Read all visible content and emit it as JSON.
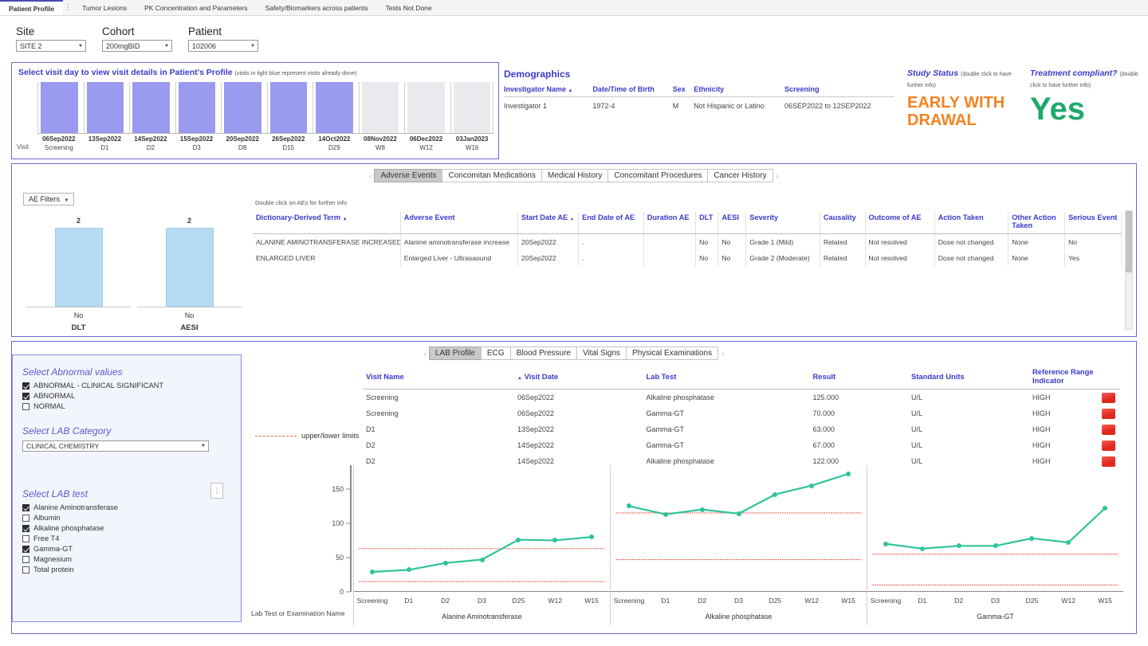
{
  "topbar": {
    "tabs": [
      {
        "label": "Patient Profile",
        "active": true
      },
      {
        "label": "Tumor Lesions",
        "active": false
      },
      {
        "label": "PK Concentration and Parameters",
        "active": false
      },
      {
        "label": "Safety/Biomarkers across patients",
        "active": false
      },
      {
        "label": "Tests Not Done",
        "active": false
      }
    ],
    "kebab": "⋮"
  },
  "selectors": [
    {
      "label": "Site",
      "value": "SITE 2"
    },
    {
      "label": "Cohort",
      "value": "200mgBID"
    },
    {
      "label": "Patient",
      "value": "102006"
    }
  ],
  "visit_panel": {
    "title": "Select visit day to view visit details in Patient's Profile",
    "subtitle": "(visits in light blue represent visits already done)",
    "row_label": "Visit",
    "visits": [
      {
        "date": "06Sep2022",
        "visit": "Screening",
        "done": true
      },
      {
        "date": "13Sep2022",
        "visit": "D1",
        "done": true
      },
      {
        "date": "14Sep2022",
        "visit": "D2",
        "done": true
      },
      {
        "date": "15Sep2022",
        "visit": "D3",
        "done": true
      },
      {
        "date": "20Sep2022",
        "visit": "D8",
        "done": true
      },
      {
        "date": "26Sep2022",
        "visit": "D15",
        "done": true
      },
      {
        "date": "14Oct2022",
        "visit": "D29",
        "done": true
      },
      {
        "date": "08Nov2022",
        "visit": "W8",
        "done": false
      },
      {
        "date": "06Dec2022",
        "visit": "W12",
        "done": false
      },
      {
        "date": "03Jan2023",
        "visit": "W16",
        "done": false
      }
    ]
  },
  "demographics": {
    "title": "Demographics",
    "columns": [
      "Investigator Name",
      "Date/Time of Birth",
      "Sex",
      "Ethnicity",
      "Screening"
    ],
    "rows": [
      [
        "Investigator 1",
        "1972-4",
        "M",
        "Not Hispanic or Latino",
        "06SEP2022 to 12SEP2022"
      ]
    ]
  },
  "study_status": {
    "label": "Study Status",
    "note": "(double click to have further info)",
    "value": "EARLY WITHDRAWAL",
    "color": "#f58220"
  },
  "treatment_compliant": {
    "label": "Treatment compliant?",
    "note": "(double click to have further info)",
    "value": "Yes",
    "color": "#1fa96a"
  },
  "ae_section": {
    "tabs": [
      {
        "label": "Adverse Events",
        "active": true
      },
      {
        "label": "Concomitan Medications",
        "active": false
      },
      {
        "label": "Medical History",
        "active": false
      },
      {
        "label": "Concomitant Procedures",
        "active": false
      },
      {
        "label": "Cancer History",
        "active": false
      }
    ],
    "prev_arrow": "‹",
    "next_arrow": "›",
    "filters_label": "AE Filters",
    "hint": "Double click on AEs for further info",
    "bars": [
      {
        "name": "DLT",
        "category": "No",
        "value": "2"
      },
      {
        "name": "AESI",
        "category": "No",
        "value": "2"
      }
    ],
    "columns": [
      "Dictionary-Derived Term",
      "Adverse Event",
      "Start Date AE",
      "End Date of AE",
      "Duration AE",
      "DLT",
      "AESI",
      "Severity",
      "Causality",
      "Outcome of AE",
      "Action Taken",
      "Other Action Taken",
      "Serious Event"
    ],
    "rows": [
      [
        "ALANINE AMINOTRANSFERASE INCREASED",
        "Alanine aminotransferase increase",
        "20Sep2022",
        ".",
        "",
        "No",
        "No",
        "Grade 1 (Mild)",
        "Related",
        "Not resolved",
        "Dose not changed",
        "None",
        "No"
      ],
      [
        "ENLARGED LIVER",
        "Enlarged Liver - Ultrasaound",
        "20Sep2022",
        ".",
        "",
        "No",
        "No",
        "Grade 2 (Moderate)",
        "Related",
        "Not resolved",
        "Dose not changed",
        "None",
        "Yes"
      ]
    ]
  },
  "lab_section": {
    "tabs": [
      {
        "label": "LAB Profile",
        "active": true
      },
      {
        "label": "ECG",
        "active": false
      },
      {
        "label": "Blood Pressure",
        "active": false
      },
      {
        "label": "Vital Signs",
        "active": false
      },
      {
        "label": "Physical Examinations",
        "active": false
      }
    ],
    "prev_arrow": "‹",
    "next_arrow": "›",
    "filters": {
      "abnormal_title": "Select Abnormal values",
      "abnormal_options": [
        {
          "label": "ABNORMAL - CLINICAL SIGNIFICANT",
          "checked": true
        },
        {
          "label": "ABNORMAL",
          "checked": true
        },
        {
          "label": "NORMAL",
          "checked": false
        }
      ],
      "category_title": "Select LAB Category",
      "category_value": "CLINICAL CHEMISTRY",
      "test_title": "Select LAB test",
      "test_options": [
        {
          "label": "Alanine Aminotransferase",
          "checked": true
        },
        {
          "label": "Albumin",
          "checked": false
        },
        {
          "label": "Alkaline phosphatase",
          "checked": true
        },
        {
          "label": "Free T4",
          "checked": false
        },
        {
          "label": "Gamma-GT",
          "checked": true
        },
        {
          "label": "Magnesium",
          "checked": false
        },
        {
          "label": "Total protein",
          "checked": false
        }
      ],
      "kebab": "⋮"
    },
    "columns": [
      "Visit Name",
      "Visit Date",
      "Lab Test",
      "Result",
      "Standard Units",
      "Reference Range Indicator"
    ],
    "rows": [
      [
        "Screening",
        "06Sep2022",
        "Alkaline phosphatase",
        "125.000",
        "U/L",
        "HIGH"
      ],
      [
        "Screening",
        "06Sep2022",
        "Gamma-GT",
        "70.000",
        "U/L",
        "HIGH"
      ],
      [
        "D1",
        "13Sep2022",
        "Gamma-GT",
        "63.000",
        "U/L",
        "HIGH"
      ],
      [
        "D2",
        "14Sep2022",
        "Gamma-GT",
        "67.000",
        "U/L",
        "HIGH"
      ],
      [
        "D2",
        "14Sep2022",
        "Alkaline phosphatase",
        "122.000",
        "U/L",
        "HIGH"
      ]
    ],
    "legend_label": "upper/lower limits",
    "axis_title": "Lab Test or Examination Name"
  },
  "chart_data": [
    {
      "type": "line",
      "title": "Alanine Aminotransferase",
      "xlabel": "Lab Test or Examination Name",
      "ylabel": "",
      "categories": [
        "Screening",
        "D1",
        "D2",
        "D3",
        "D25",
        "W12",
        "W15"
      ],
      "values": [
        29,
        32,
        42,
        47,
        76,
        75,
        80
      ],
      "upper_limit": 63,
      "lower_limit": 15,
      "ylim": [
        0,
        180
      ],
      "yticks": [
        0,
        50,
        100,
        150
      ],
      "series_color": "#2ec496",
      "limit_color": "#e8433a",
      "grid": false,
      "legend": "upper/lower limits"
    },
    {
      "type": "line",
      "title": "Alkaline phosphatase",
      "xlabel": "Lab Test or Examination Name",
      "ylabel": "",
      "categories": [
        "Screening",
        "D1",
        "D2",
        "D3",
        "D25",
        "W12",
        "W15"
      ],
      "values": [
        125,
        113,
        120,
        114,
        142,
        155,
        172
      ],
      "upper_limit": 115,
      "lower_limit": 47,
      "ylim": [
        0,
        180
      ],
      "yticks": [
        0,
        50,
        100,
        150
      ],
      "series_color": "#2ec496",
      "limit_color": "#e8433a",
      "grid": false,
      "legend": "upper/lower limits"
    },
    {
      "type": "line",
      "title": "Gamma-GT",
      "xlabel": "Lab Test or Examination Name",
      "ylabel": "",
      "categories": [
        "Screening",
        "D1",
        "D2",
        "D3",
        "D25",
        "W12",
        "W15"
      ],
      "values": [
        70,
        63,
        67,
        67,
        78,
        72,
        122
      ],
      "upper_limit": 55,
      "lower_limit": 10,
      "ylim": [
        0,
        180
      ],
      "yticks": [
        0,
        50,
        100,
        150
      ],
      "series_color": "#2ec496",
      "limit_color": "#e8433a",
      "grid": false,
      "legend": "upper/lower limits"
    }
  ]
}
